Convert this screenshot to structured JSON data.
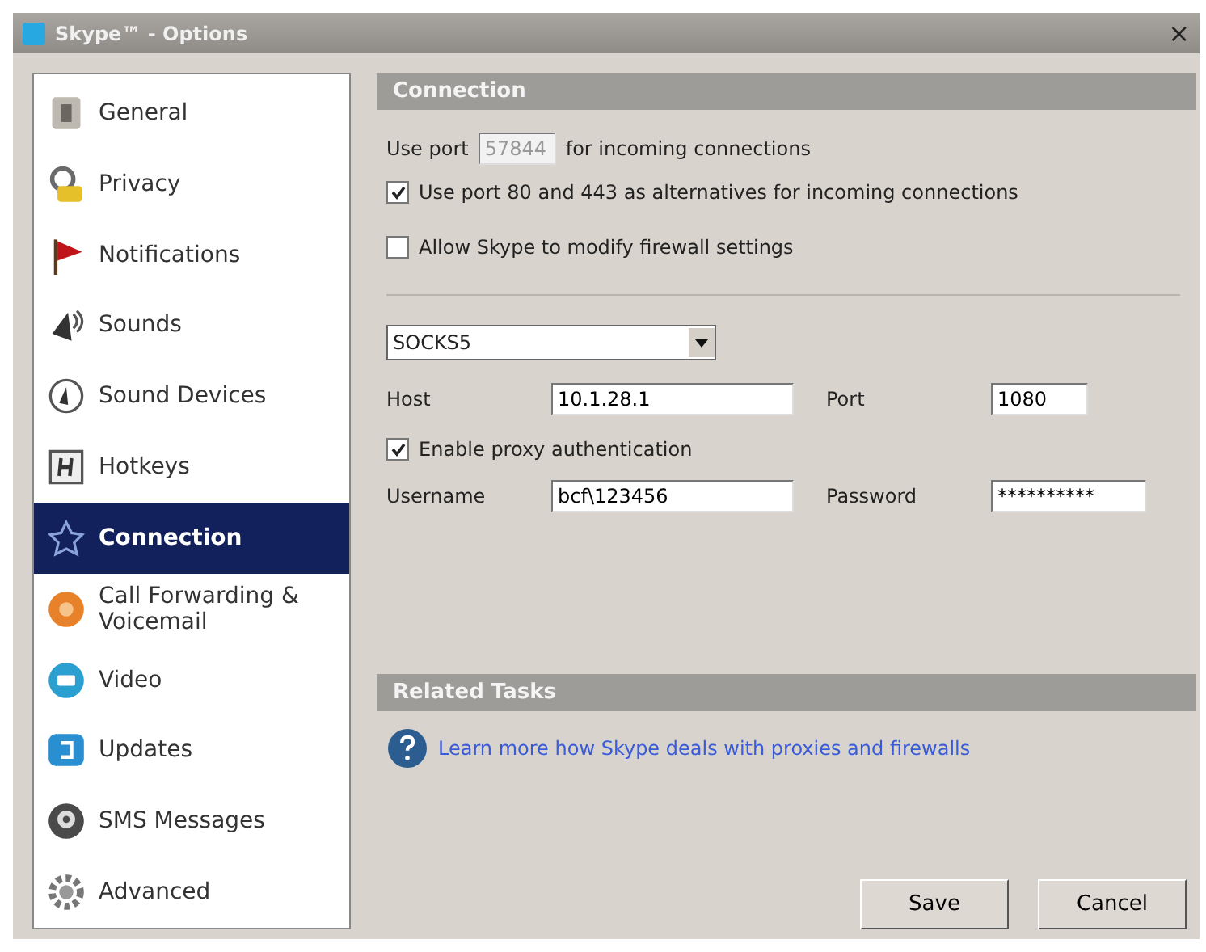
{
  "window": {
    "title": "Skype™ - Options",
    "close": "×"
  },
  "sidebar": {
    "items": [
      {
        "label": "General",
        "selected": false
      },
      {
        "label": "Privacy",
        "selected": false
      },
      {
        "label": "Notifications",
        "selected": false
      },
      {
        "label": "Sounds",
        "selected": false
      },
      {
        "label": "Sound Devices",
        "selected": false
      },
      {
        "label": "Hotkeys",
        "selected": false
      },
      {
        "label": "Connection",
        "selected": true
      },
      {
        "label": "Call Forwarding & Voicemail",
        "selected": false
      },
      {
        "label": "Video",
        "selected": false
      },
      {
        "label": "Updates",
        "selected": false
      },
      {
        "label": "SMS Messages",
        "selected": false
      },
      {
        "label": "Advanced",
        "selected": false
      }
    ]
  },
  "connection": {
    "title": "Connection",
    "port_before": "Use port",
    "port": {
      "value": "57844",
      "disabled": true
    },
    "port_after": "for incoming connections",
    "checkboxes": [
      {
        "label": "Use port 80 and 443 as alternatives for incoming connections",
        "checked": true
      },
      {
        "label": "Allow Skype to modify firewall settings",
        "checked": false
      }
    ],
    "proxy_type": "SOCKS5",
    "host": {
      "label": "Host",
      "value": "10.1.28.1"
    },
    "port_field": {
      "label": "Port",
      "value": "1080"
    },
    "auth": {
      "label": "Enable proxy authentication",
      "checked": true
    },
    "username": {
      "label": "Username",
      "value": "bcf\\123456"
    },
    "password": {
      "label": "Password",
      "value": "**********"
    }
  },
  "related": {
    "title": "Related Tasks",
    "link": "Learn more how Skype deals with proxies and firewalls"
  },
  "buttons": [
    "Save",
    "Cancel"
  ]
}
